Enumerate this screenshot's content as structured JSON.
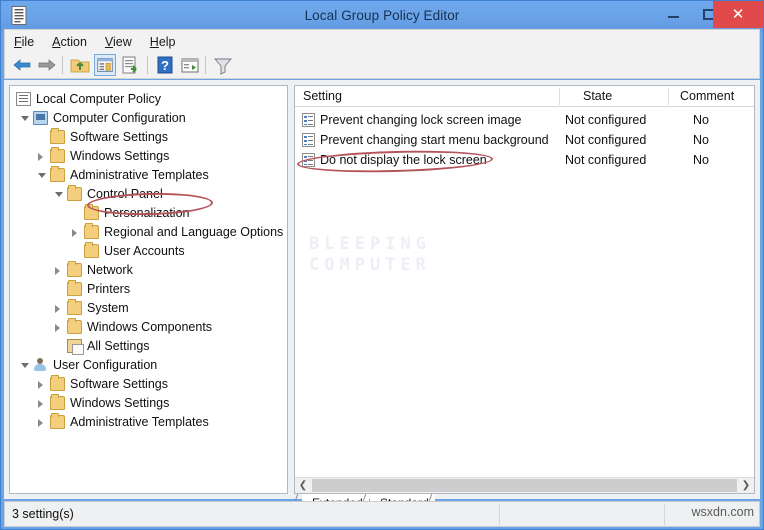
{
  "window": {
    "title": "Local Group Policy Editor",
    "app_icon": "policy-document-icon",
    "minimize_label": "–",
    "maximize_label": "□",
    "close_label": "✕",
    "titlebar_color": "#6aa3e8",
    "close_button_color": "#e04a4a"
  },
  "menubar": {
    "items": [
      {
        "label": "File",
        "accel": "F"
      },
      {
        "label": "Action",
        "accel": "A"
      },
      {
        "label": "View",
        "accel": "V"
      },
      {
        "label": "Help",
        "accel": "H"
      }
    ]
  },
  "toolbar": {
    "buttons": [
      {
        "name": "back-icon",
        "tip": "Back"
      },
      {
        "name": "forward-icon",
        "tip": "Forward"
      },
      {
        "name": "up-folder-icon",
        "tip": "Up One Level"
      },
      {
        "name": "show-hide-tree-icon",
        "tip": "Show/Hide Console Tree",
        "active": true
      },
      {
        "name": "export-list-icon",
        "tip": "Export List"
      },
      {
        "name": "help-icon",
        "tip": "Help"
      },
      {
        "name": "properties-icon",
        "tip": "Properties"
      },
      {
        "name": "filter-icon",
        "tip": "Filter"
      }
    ]
  },
  "tree": {
    "items": [
      {
        "label": "Local Computer Policy",
        "depth": 0,
        "icon": "policy-document-icon",
        "expander": "none"
      },
      {
        "label": "Computer Configuration",
        "depth": 1,
        "icon": "computer-icon",
        "expander": "open"
      },
      {
        "label": "Software Settings",
        "depth": 2,
        "icon": "folder-icon",
        "expander": "none"
      },
      {
        "label": "Windows Settings",
        "depth": 2,
        "icon": "folder-icon",
        "expander": "closed"
      },
      {
        "label": "Administrative Templates",
        "depth": 2,
        "icon": "folder-icon",
        "expander": "open"
      },
      {
        "label": "Control Panel",
        "depth": 3,
        "icon": "folder-icon",
        "expander": "open"
      },
      {
        "label": "Personalization",
        "depth": 4,
        "icon": "folder-icon",
        "expander": "none",
        "highlighted": true
      },
      {
        "label": "Regional and Language Options",
        "depth": 4,
        "icon": "folder-icon",
        "expander": "closed"
      },
      {
        "label": "User Accounts",
        "depth": 4,
        "icon": "folder-icon",
        "expander": "none"
      },
      {
        "label": "Network",
        "depth": 3,
        "icon": "folder-icon",
        "expander": "closed"
      },
      {
        "label": "Printers",
        "depth": 3,
        "icon": "folder-icon",
        "expander": "none"
      },
      {
        "label": "System",
        "depth": 3,
        "icon": "folder-icon",
        "expander": "closed"
      },
      {
        "label": "Windows Components",
        "depth": 3,
        "icon": "folder-icon",
        "expander": "closed"
      },
      {
        "label": "All Settings",
        "depth": 3,
        "icon": "all-settings-icon",
        "expander": "none"
      },
      {
        "label": "User Configuration",
        "depth": 1,
        "icon": "user-icon",
        "expander": "open"
      },
      {
        "label": "Software Settings",
        "depth": 2,
        "icon": "folder-icon",
        "expander": "closed"
      },
      {
        "label": "Windows Settings",
        "depth": 2,
        "icon": "folder-icon",
        "expander": "closed"
      },
      {
        "label": "Administrative Templates",
        "depth": 2,
        "icon": "folder-icon",
        "expander": "closed"
      }
    ]
  },
  "list": {
    "columns": [
      {
        "label": "Setting"
      },
      {
        "label": "State"
      },
      {
        "label": "Comment"
      }
    ],
    "rows": [
      {
        "setting": "Prevent changing lock screen image",
        "state": "Not configured",
        "comment": "No"
      },
      {
        "setting": "Prevent changing start menu background",
        "state": "Not configured",
        "comment": "No"
      },
      {
        "setting": "Do not display the lock screen",
        "state": "Not configured",
        "comment": "No",
        "highlighted": true
      }
    ],
    "watermark_line1": "BLEEPING",
    "watermark_line2": "COMPUTER",
    "scroll_left_glyph": "❮",
    "scroll_right_glyph": "❯"
  },
  "tabs": [
    {
      "label": "Extended",
      "selected": false
    },
    {
      "label": "Standard",
      "selected": true
    }
  ],
  "statusbar": {
    "text": "3 setting(s)",
    "watermark": "wsxdn.com"
  },
  "annotations": {
    "color": "#b4545a",
    "ovals": [
      {
        "name": "oval-personalization",
        "target": "Personalization"
      },
      {
        "name": "oval-lockscreen",
        "target": "Do not display the lock screen"
      }
    ]
  }
}
